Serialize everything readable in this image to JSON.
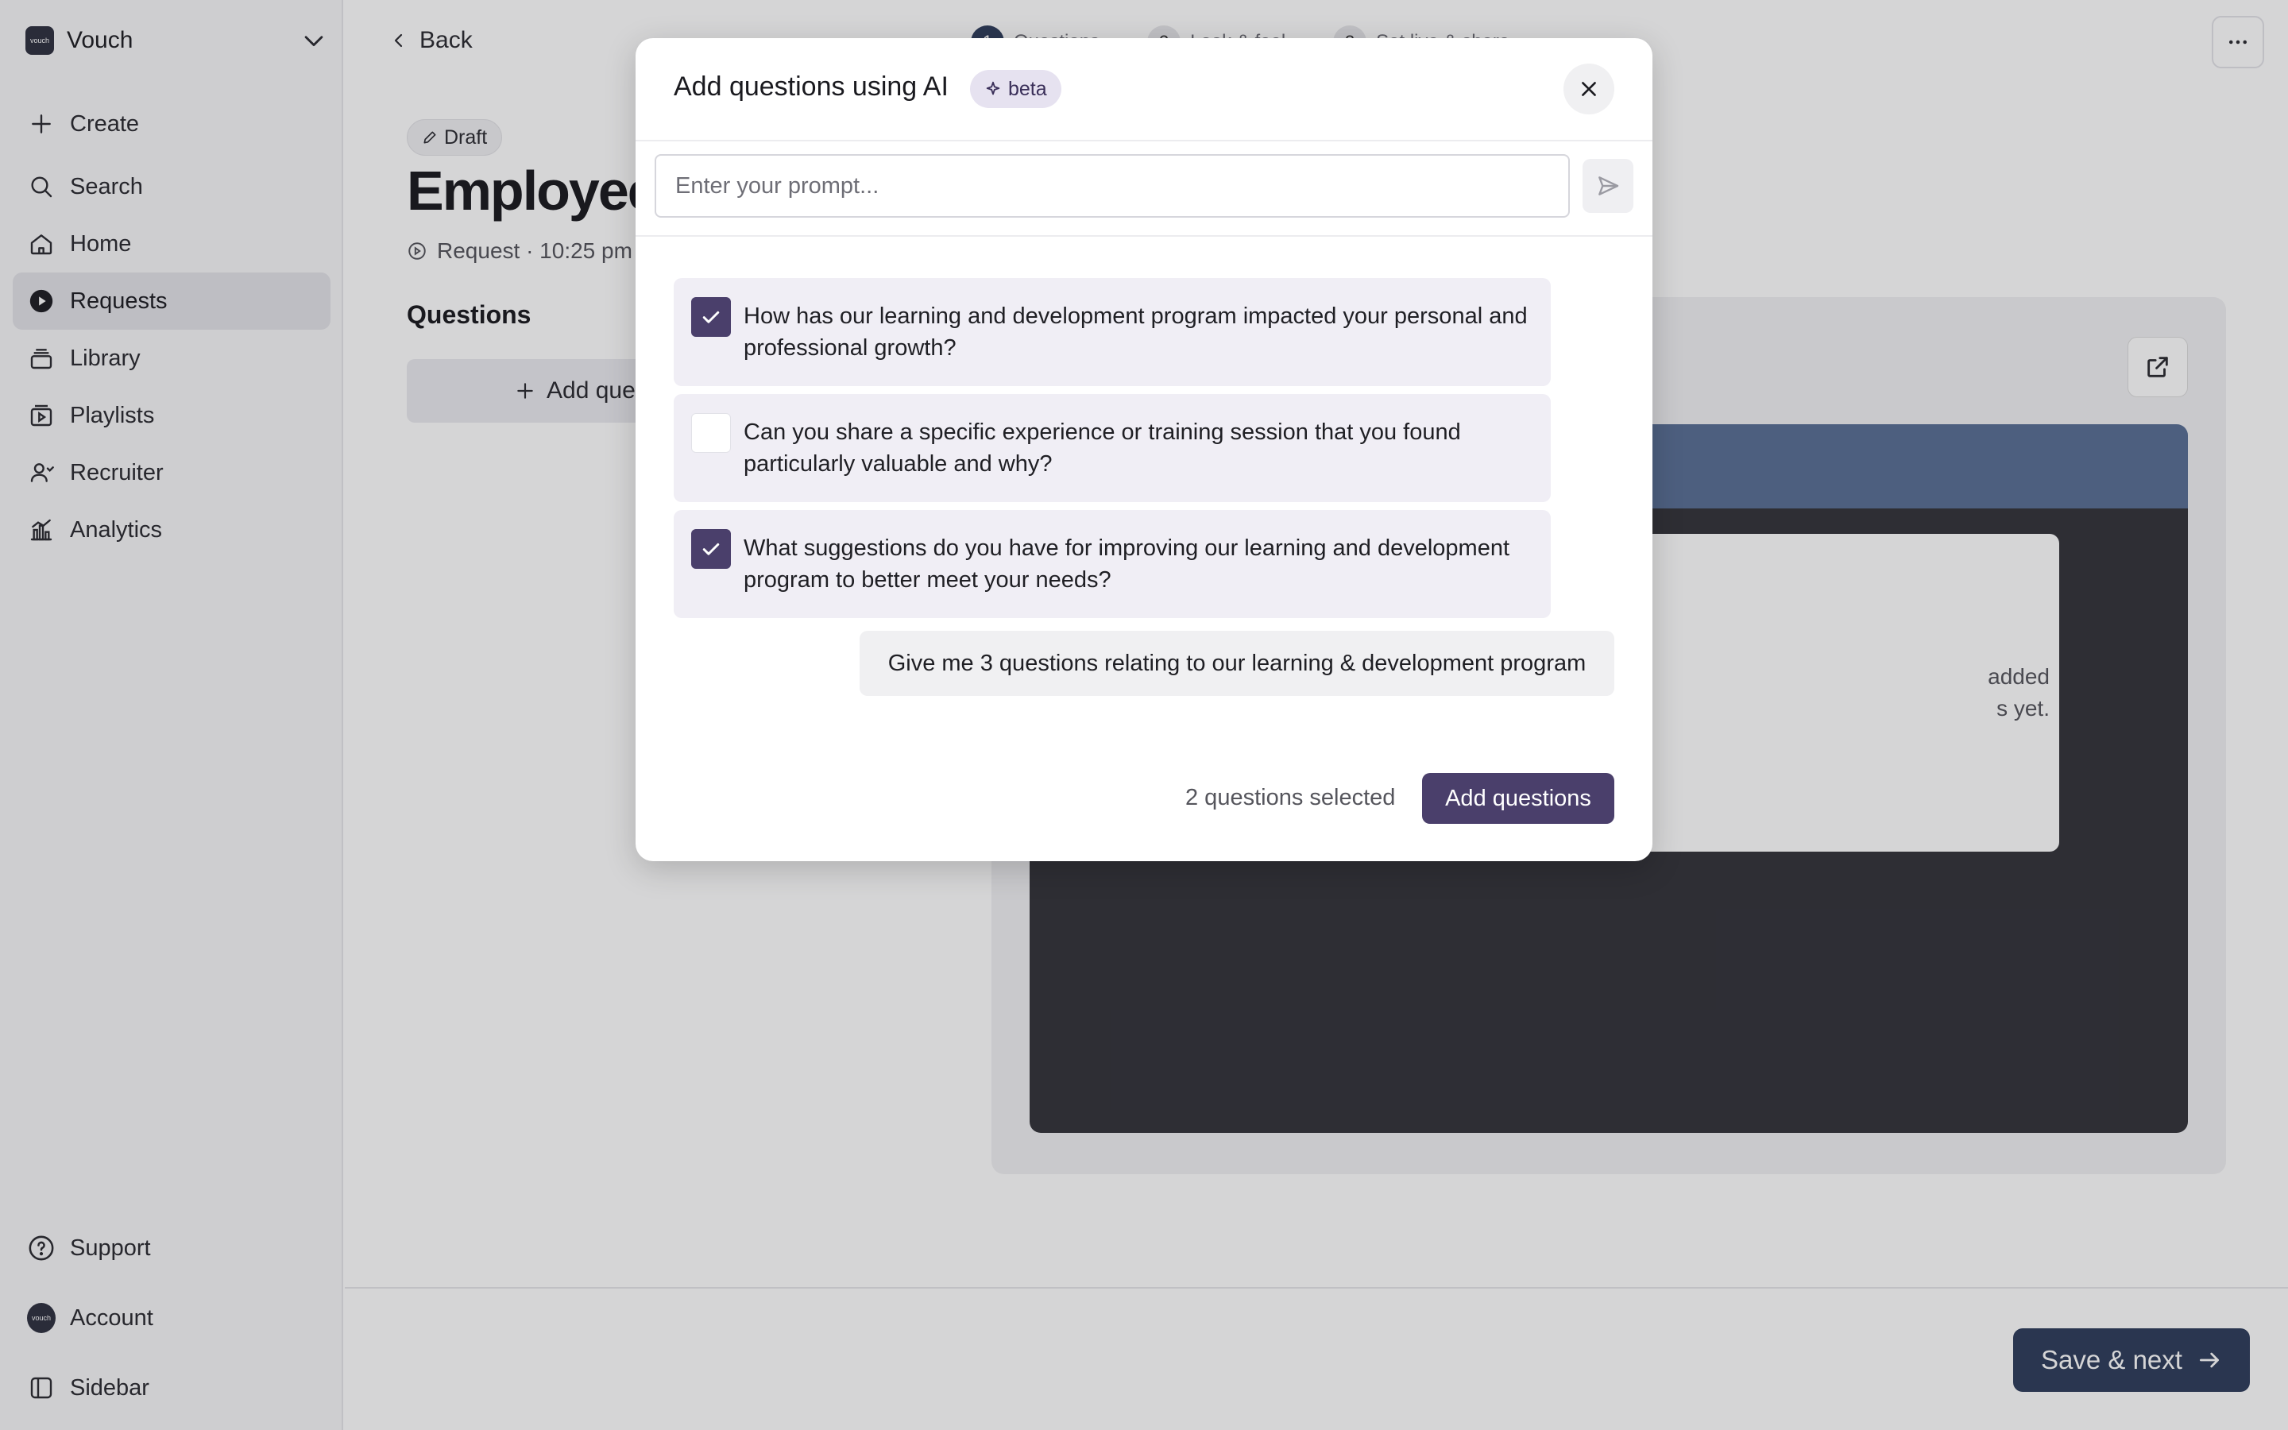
{
  "brand": {
    "name": "Vouch",
    "logo_text": "vouch"
  },
  "sidebar": {
    "items": [
      {
        "label": "Create",
        "icon": "plus-icon"
      },
      {
        "label": "Search",
        "icon": "search-icon"
      },
      {
        "label": "Home",
        "icon": "home-icon"
      },
      {
        "label": "Requests",
        "icon": "requests-icon",
        "active": true
      },
      {
        "label": "Library",
        "icon": "library-icon"
      },
      {
        "label": "Playlists",
        "icon": "playlists-icon"
      },
      {
        "label": "Recruiter",
        "icon": "recruiter-icon"
      },
      {
        "label": "Analytics",
        "icon": "analytics-icon"
      }
    ],
    "bottom": [
      {
        "label": "Support",
        "icon": "help-icon"
      },
      {
        "label": "Account",
        "icon": "avatar-icon"
      },
      {
        "label": "Sidebar",
        "icon": "sidebar-toggle-icon"
      }
    ]
  },
  "header": {
    "back_label": "Back",
    "steps": [
      {
        "num": "1",
        "label": "Questions"
      },
      {
        "num": "2",
        "label": "Look & feel"
      },
      {
        "num": "3",
        "label": "Set live & share"
      }
    ]
  },
  "main": {
    "status": "Draft",
    "title": "Employee S",
    "meta": "Request · 10:25 pm",
    "questions_heading": "Questions",
    "add_question_label": "Add que"
  },
  "preview": {
    "empty_line1": "added",
    "empty_line2": "s yet."
  },
  "footer": {
    "save_next_label": "Save & next"
  },
  "modal": {
    "title": "Add questions using AI",
    "badge": "beta",
    "prompt_placeholder": "Enter your prompt...",
    "prompt_value": "",
    "questions": [
      {
        "text": "How has our learning and development program impacted your personal and professional growth?",
        "checked": true
      },
      {
        "text": "Can you share a specific experience or training session that you found particularly valuable and why?",
        "checked": false
      },
      {
        "text": "What suggestions do you have for improving our learning and development program to better meet your needs?",
        "checked": true
      }
    ],
    "user_prompt": "Give me 3 questions relating to our learning & development program",
    "selected_count_text": "2 questions selected",
    "add_button_label": "Add questions"
  },
  "colors": {
    "accent": "#4a3f6b",
    "primary_dark": "#2f3e5c",
    "preview_header": "#5a6f95"
  }
}
